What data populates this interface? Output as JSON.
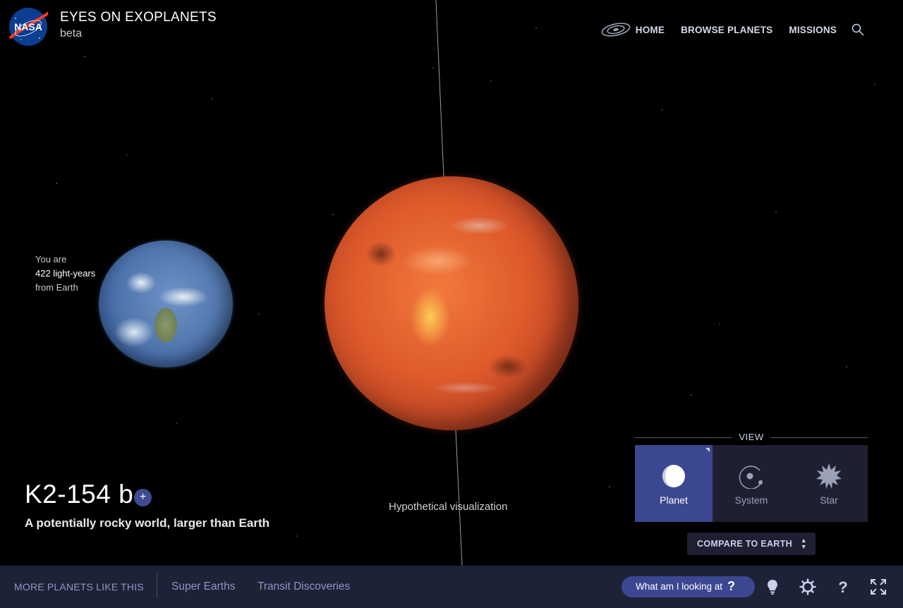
{
  "header": {
    "title": "EYES ON EXOPLANETS",
    "subtitle": "beta",
    "logo_text": "NASA",
    "nav": [
      "HOME",
      "BROWSE PLANETS",
      "MISSIONS"
    ]
  },
  "distance": {
    "line1": "You are",
    "line2": "422 light-years",
    "line3": "from Earth"
  },
  "planet": {
    "name": "K2-154 b",
    "add_symbol": "+",
    "tagline": "A potentially rocky world, larger than Earth"
  },
  "visualization_note": "Hypothetical visualization",
  "view": {
    "label": "VIEW",
    "options": [
      "Planet",
      "System",
      "Star"
    ],
    "selected": "Planet"
  },
  "compare_button": "COMPARE TO EARTH",
  "bottom_bar": {
    "more_label": "MORE PLANETS LIKE THIS",
    "links": [
      "Super Earths",
      "Transit Discoveries"
    ],
    "looking_button": "What am I looking at",
    "looking_symbol": "?",
    "icons": [
      "lightbulb-icon",
      "settings-icon",
      "help-icon",
      "fullscreen-icon"
    ]
  },
  "colors": {
    "accent": "#3b4791",
    "panel": "#1e2031",
    "bar": "#1d2236",
    "link": "#8f97c4"
  }
}
